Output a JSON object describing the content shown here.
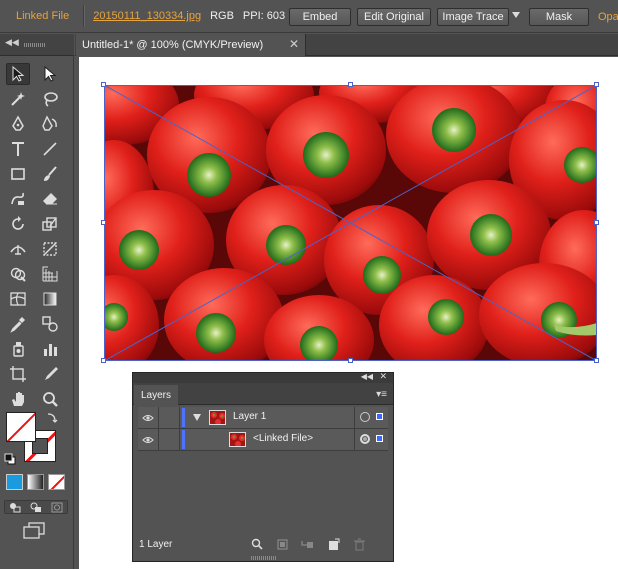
{
  "control_bar": {
    "linked_label": "Linked File",
    "filename": "20150111_130334.jpg",
    "color_mode": "RGB",
    "ppi": "PPI: 603",
    "embed": "Embed",
    "edit_original": "Edit Original",
    "image_trace": "Image Trace",
    "mask": "Mask",
    "opacity_label": "Opac"
  },
  "document": {
    "tab_title": "Untitled-1* @ 100% (CMYK/Preview)",
    "close_glyph": "✕"
  },
  "tools": {
    "collapse_glyph": "◀◀",
    "items": [
      "selection-tool",
      "direct-selection-tool",
      "magic-wand-tool",
      "lasso-tool",
      "pen-tool",
      "curvature-tool",
      "type-tool",
      "line-segment-tool",
      "rectangle-tool",
      "paintbrush-tool",
      "shaper-tool",
      "eraser-tool",
      "rotate-tool",
      "scale-tool",
      "width-tool",
      "free-transform-tool",
      "shape-builder-tool",
      "perspective-grid-tool",
      "mesh-tool",
      "gradient-tool",
      "eyedropper-tool",
      "blend-tool",
      "symbol-sprayer-tool",
      "column-graph-tool",
      "artboard-tool",
      "slice-tool",
      "hand-tool",
      "zoom-tool"
    ]
  },
  "colors": {
    "accent_orange": "#e8a33c",
    "selection_blue": "#4d62c9",
    "layer_blue": "#4e74ff",
    "fill_blue": "#1a9be0"
  },
  "layers": {
    "tab_label": "Layers",
    "collapse_glyph": "◀◀",
    "close_glyph": "✕",
    "menu_glyph": "▾≡",
    "rows": [
      {
        "name": "Layer 1"
      },
      {
        "name": "<Linked File>"
      }
    ],
    "count_label": "1 Layer"
  }
}
